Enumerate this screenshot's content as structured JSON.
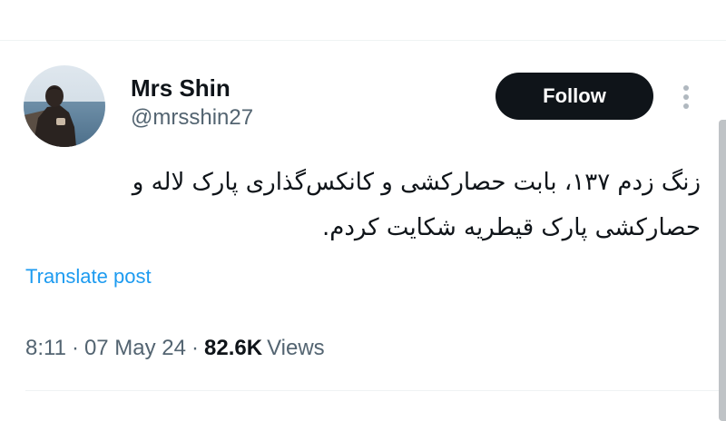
{
  "author": {
    "display_name": "Mrs Shin",
    "handle": "@mrsshin27"
  },
  "actions": {
    "follow_label": "Follow",
    "more_icon": "vertical-dots-icon"
  },
  "tweet": {
    "lines": [
      "زنگ زدم ۱۳۷، بابت حصارکشی و کانکس‌گذاری پارک لاله و",
      "حصارکشی پارک قیطریه شکایت کردم."
    ],
    "translate_label": "Translate post"
  },
  "meta": {
    "time": "8:11",
    "separator": "·",
    "date": "07 May 24",
    "views_count": "82.6K",
    "views_label": "Views"
  },
  "colors": {
    "text_primary": "#0f1419",
    "text_secondary": "#536471",
    "link": "#1d9bf0",
    "button_bg": "#0f1419",
    "button_text": "#ffffff",
    "divider": "#eff3f4"
  }
}
